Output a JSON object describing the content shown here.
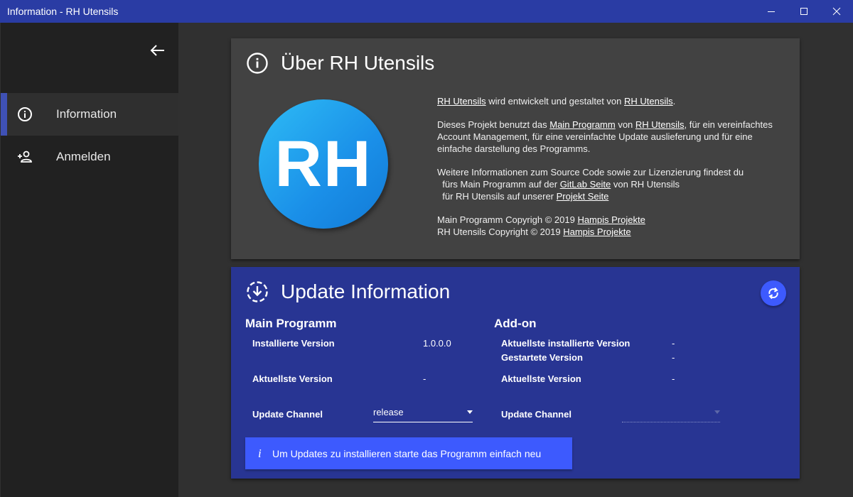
{
  "window": {
    "title": "Information - RH Utensils",
    "controls": [
      "minimize-icon",
      "maximize-icon",
      "close-icon"
    ]
  },
  "sidebar": {
    "back_icon": "arrow-left-icon",
    "items": [
      {
        "label": "Information",
        "icon": "info-circle-icon",
        "active": true
      },
      {
        "label": "Anmelden",
        "icon": "person-add-icon",
        "active": false
      }
    ]
  },
  "about": {
    "title": "Über RH Utensils",
    "logo_text": "RH",
    "p1": {
      "link1": "RH Utensils",
      "t1": " wird entwickelt und gestaltet von ",
      "link2": "RH Utensils",
      "t2": "."
    },
    "p2": {
      "t1": "Dieses Projekt benutzt das ",
      "link1": "Main Programm",
      "t2": " von ",
      "link2": "RH Utensils",
      "t3": ", für ein vereinfachtes Account Management, für eine vereinfachte Update auslieferung und für eine einfache darstellung des Programms."
    },
    "p3": {
      "t1": "Weitere Informationen zum Source Code sowie zur Lizenzierung findest du",
      "t2": "fürs Main Programm auf der ",
      "link1": "GitLab Seite",
      "t3": " von RH Utensils",
      "t4": "für RH Utensils auf unserer ",
      "link2": "Projekt Seite"
    },
    "p4": {
      "t1": "Main Programm Copyrigh © 2019 ",
      "link1": "Hampis Projekte",
      "t2": "RH Utensils Copyright © 2019 ",
      "link2": "Hampis Projekte"
    }
  },
  "update": {
    "title": "Update Information",
    "refresh_icon": "refresh-icon",
    "main": {
      "title": "Main Programm",
      "installed_label": "Installierte Version",
      "installed_value": "1.0.0.0",
      "latest_label": "Aktuellste Version",
      "latest_value": "-",
      "channel_label": "Update Channel",
      "channel_value": "release"
    },
    "addon": {
      "title": "Add-on",
      "installed_label": "Aktuellste installierte Version",
      "installed_value": "-",
      "started_label": "Gestartete Version",
      "started_value": "-",
      "latest_label": "Aktuellste Version",
      "latest_value": "-",
      "channel_label": "Update Channel"
    },
    "info_icon": "i",
    "info_text": "Um Updates zu installieren starte das Programm einfach neu"
  },
  "colors": {
    "titlebar": "#2a3ca4",
    "sidebar": "#212121",
    "background": "#303030",
    "card": "#424242",
    "update_card": "#283593",
    "accent": "#3d5afe"
  }
}
